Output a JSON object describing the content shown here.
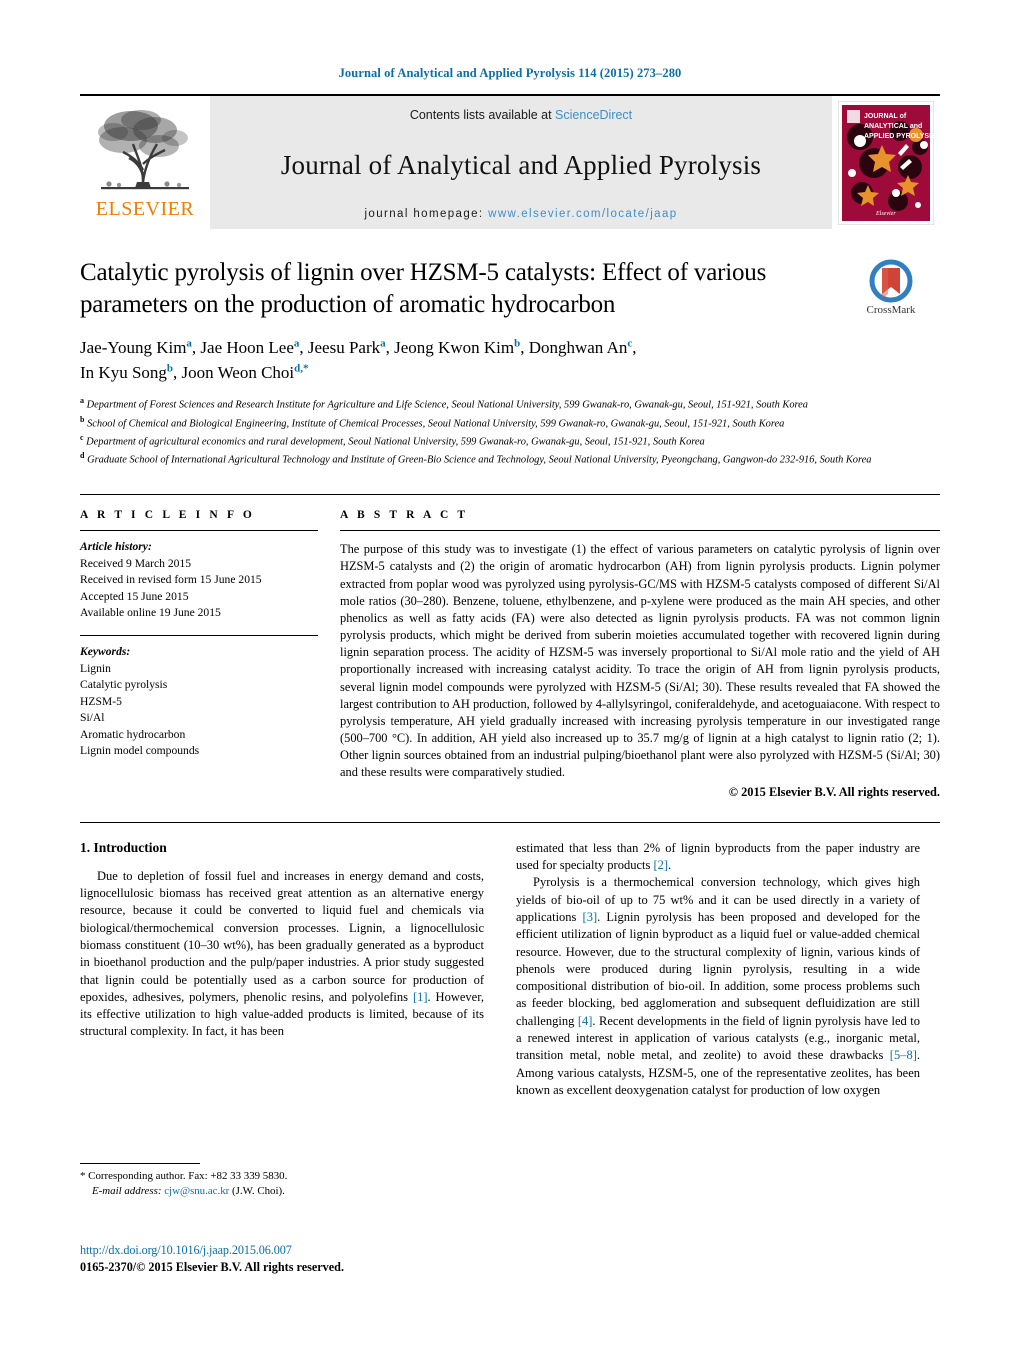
{
  "running_head": "Journal of Analytical and Applied Pyrolysis 114 (2015) 273–280",
  "masthead": {
    "publisher": "ELSEVIER",
    "contents_prefix": "Contents lists available at ",
    "contents_link": "ScienceDirect",
    "journal_title": "Journal of Analytical and Applied Pyrolysis",
    "homepage_prefix": "journal homepage: ",
    "homepage_url": "www.elsevier.com/locate/jaap",
    "cover_line1": "JOURNAL of",
    "cover_line2": "ANALYTICAL and",
    "cover_line3": "APPLIED PYROLYSIS",
    "cover_footer": "Elsevier"
  },
  "article": {
    "title": "Catalytic pyrolysis of lignin over HZSM-5 catalysts: Effect of various parameters on the production of aromatic hydrocarbon",
    "crossmark_label": "CrossMark",
    "authors_line1_part1": "Jae-Young Kim",
    "authors_line1_sup1": "a",
    "authors_line1_part2": ", Jae Hoon Lee",
    "authors_line1_sup2": "a",
    "authors_line1_part3": ", Jeesu Park",
    "authors_line1_sup3": "a",
    "authors_line1_part4": ", Jeong Kwon Kim",
    "authors_line1_sup4": "b",
    "authors_line1_part5": ", Donghwan An",
    "authors_line1_sup5": "c",
    "authors_line1_tail": ",",
    "authors_line2_part1": "In Kyu Song",
    "authors_line2_sup1": "b",
    "authors_line2_part2": ", Joon Weon Choi",
    "authors_line2_sup2": "d,",
    "authors_line2_star": "*",
    "affiliations": [
      {
        "mark": "a",
        "text": "Department of Forest Sciences and Research Institute for Agriculture and Life Science, Seoul National University, 599 Gwanak-ro, Gwanak-gu, Seoul, 151-921, South Korea"
      },
      {
        "mark": "b",
        "text": "School of Chemical and Biological Engineering, Institute of Chemical Processes, Seoul National University, 599 Gwanak-ro, Gwanak-gu, Seoul, 151-921, South Korea"
      },
      {
        "mark": "c",
        "text": "Department of agricultural economics and rural development, Seoul National University, 599 Gwanak-ro, Gwanak-gu, Seoul, 151-921, South Korea"
      },
      {
        "mark": "d",
        "text": "Graduate School of International Agricultural Technology and Institute of Green-Bio Science and Technology, Seoul National University, Pyeongchang, Gangwon-do 232-916, South Korea"
      }
    ]
  },
  "article_info": {
    "heading": "A R T I C L E    I N F O",
    "history_label": "Article history:",
    "history": [
      "Received 9 March 2015",
      "Received in revised form 15 June 2015",
      "Accepted 15 June 2015",
      "Available online 19 June 2015"
    ],
    "keywords_label": "Keywords:",
    "keywords": [
      "Lignin",
      "Catalytic pyrolysis",
      "HZSM-5",
      "Si/Al",
      "Aromatic hydrocarbon",
      "Lignin model compounds"
    ]
  },
  "abstract": {
    "heading": "A B S T R A C T",
    "text": "The purpose of this study was to investigate (1) the effect of various parameters on catalytic pyrolysis of lignin over HZSM-5 catalysts and (2) the origin of aromatic hydrocarbon (AH) from lignin pyrolysis products. Lignin polymer extracted from poplar wood was pyrolyzed using pyrolysis-GC/MS with HZSM-5 catalysts composed of different Si/Al mole ratios (30–280). Benzene, toluene, ethylbenzene, and p-xylene were produced as the main AH species, and other phenolics as well as fatty acids (FA) were also detected as lignin pyrolysis products. FA was not common lignin pyrolysis products, which might be derived from suberin moieties accumulated together with recovered lignin during lignin separation process. The acidity of HZSM-5 was inversely proportional to Si/Al mole ratio and the yield of AH proportionally increased with increasing catalyst acidity. To trace the origin of AH from lignin pyrolysis products, several lignin model compounds were pyrolyzed with HZSM-5 (Si/Al; 30). These results revealed that FA showed the largest contribution to AH production, followed by 4-allylsyringol, coniferaldehyde, and acetoguaiacone. With respect to pyrolysis temperature, AH yield gradually increased with increasing pyrolysis temperature in our investigated range (500–700 °C). In addition, AH yield also increased up to 35.7 mg/g of lignin at a high catalyst to lignin ratio (2; 1). Other lignin sources obtained from an industrial pulping/bioethanol plant were also pyrolyzed with HZSM-5 (Si/Al; 30) and these results were comparatively studied.",
    "copyright": "© 2015 Elsevier B.V. All rights reserved."
  },
  "introduction": {
    "heading": "1.  Introduction",
    "left_para1_a": "Due to depletion of fossil fuel and increases in energy demand and costs, lignocellulosic biomass has received great attention as an alternative energy resource, because it could be converted to liquid fuel and chemicals via biological/thermochemical conversion processes. Lignin, a lignocellulosic biomass constituent (10–30 wt%), has been gradually generated as a byproduct in bioethanol production and the pulp/paper industries. A prior study suggested that lignin could be potentially used as a carbon source for production of epoxides, adhesives, polymers, phenolic resins, and polyolefins ",
    "left_ref1": "[1]",
    "left_para1_b": ". However, its effective utilization to high value-added products is limited, because of its structural complexity. In fact, it has been ",
    "right_cont_a": "estimated that less than 2% of lignin byproducts from the paper industry are used for specialty products ",
    "right_ref2": "[2]",
    "right_cont_b": ".",
    "right_para2_a": "Pyrolysis is a thermochemical conversion technology, which gives high yields of bio-oil of up to 75 wt% and it can be used directly in a variety of applications ",
    "right_ref3": "[3]",
    "right_para2_b": ". Lignin pyrolysis has been proposed and developed for the efficient utilization of lignin byproduct as a liquid fuel or value-added chemical resource. However, due to the structural complexity of lignin, various kinds of phenols were produced during lignin pyrolysis, resulting in a wide compositional distribution of bio-oil. In addition, some process problems such as feeder blocking, bed agglomeration and subsequent defluidization are still challenging ",
    "right_ref4": "[4]",
    "right_para2_c": ". Recent developments in the field of lignin pyrolysis have led to a renewed interest in application of various catalysts (e.g., inorganic metal, transition metal, noble metal, and zeolite) to avoid these drawbacks ",
    "right_ref5": "[5–8]",
    "right_para2_d": ". Among various catalysts, HZSM-5, one of the representative zeolites, has been known as excellent deoxygenation catalyst for production of low oxygen"
  },
  "footer": {
    "corresponding_marker": "*",
    "corresponding_text": " Corresponding author. Fax: +82 33 339 5830.",
    "email_label": "E-mail address:",
    "email": "cjw@snu.ac.kr",
    "email_owner": " (J.W. Choi).",
    "doi": "http://dx.doi.org/10.1016/j.jaap.2015.06.007",
    "issn_line": "0165-2370/© 2015 Elsevier B.V. All rights reserved."
  },
  "colors": {
    "link_blue": "#0a6fa8",
    "light_blue": "#3d8fc9",
    "elsevier_orange": "#f07d00",
    "cover_red": "#9e0b3a",
    "band_gray": "#e9e9e9"
  }
}
